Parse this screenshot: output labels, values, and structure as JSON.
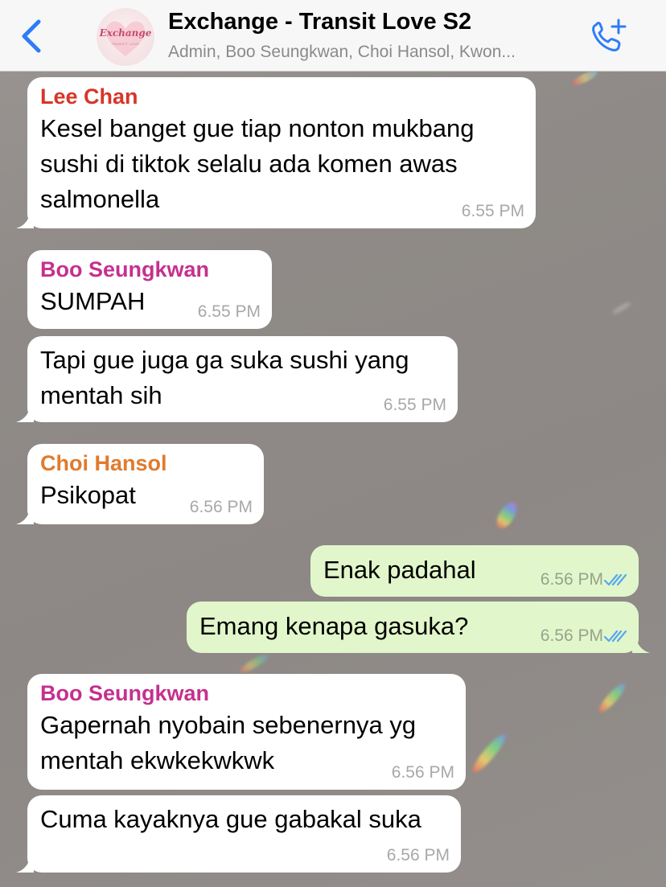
{
  "header": {
    "title": "Exchange - Transit Love S2",
    "subtitle": "Admin, Boo Seungkwan, Choi Hansol, Kwon...",
    "avatar_text": "Exchange",
    "avatar_subtext": "TRANSIT LOVE"
  },
  "colors": {
    "accent": "#2f7cf6",
    "lee_chan": "#d8352a",
    "boo_seungkwan": "#c5308f",
    "choi_hansol": "#e07b2e",
    "outgoing_bubble": "#e1f7cb",
    "incoming_bubble": "#ffffff",
    "read_ticks": "#58a6f0"
  },
  "messages": [
    {
      "sender": "Lee Chan",
      "lines": [
        "Kesel banget gue tiap nonton mukbang",
        "sushi di tiktok selalu ada komen awas",
        "salmonella"
      ],
      "time": "6.55 PM"
    },
    {
      "sender": "Boo Seungkwan",
      "lines": [
        "SUMPAH"
      ],
      "time": "6.55 PM"
    },
    {
      "sender": "",
      "lines": [
        "Tapi gue juga ga suka sushi yang",
        "mentah sih"
      ],
      "time": "6.55 PM"
    },
    {
      "sender": "Choi Hansol",
      "lines": [
        "Psikopat"
      ],
      "time": "6.56 PM"
    },
    {
      "sender": "",
      "lines": [
        "Enak padahal"
      ],
      "time": "6.56 PM",
      "outgoing": true,
      "status": "read"
    },
    {
      "sender": "",
      "lines": [
        "Emang kenapa gasuka?"
      ],
      "time": "6.56 PM",
      "outgoing": true,
      "status": "read"
    },
    {
      "sender": "Boo Seungkwan",
      "lines": [
        "Gapernah nyobain sebenernya yg",
        "mentah ekwkekwkwk"
      ],
      "time": "6.56 PM"
    },
    {
      "sender": "",
      "lines": [
        "Cuma kayaknya gue gabakal suka"
      ],
      "time": "6.56 PM"
    }
  ]
}
